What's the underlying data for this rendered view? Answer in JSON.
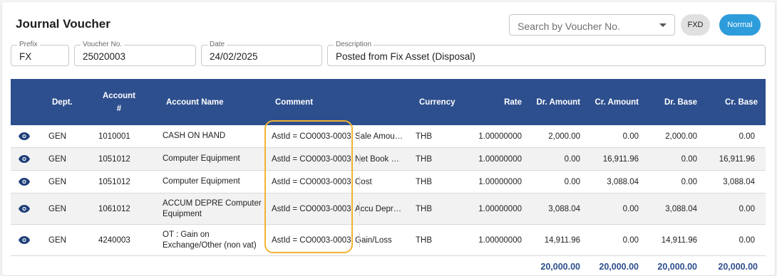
{
  "header": {
    "title": "Journal Voucher",
    "search_placeholder": "Search by Voucher No.",
    "pill_fxd": "FXD",
    "pill_normal": "Normal"
  },
  "form": {
    "prefix": {
      "label": "Prefix",
      "value": "FX"
    },
    "voucher_no": {
      "label": "Voucher No.",
      "value": "25020003"
    },
    "date": {
      "label": "Date",
      "value": "24/02/2025"
    },
    "description": {
      "label": "Description",
      "value": "Posted from Fix Asset (Disposal)"
    }
  },
  "table": {
    "columns": {
      "dept": "Dept.",
      "account_no_1": "Account",
      "account_no_2": "#",
      "account_name": "Account Name",
      "comment": "Comment",
      "currency": "Currency",
      "rate": "Rate",
      "dr_amount": "Dr. Amount",
      "cr_amount": "Cr. Amount",
      "dr_base": "Dr. Base",
      "cr_base": "Cr. Base"
    },
    "rows": [
      {
        "dept": "GEN",
        "account": "1010001",
        "account_name": "CASH ON HAND",
        "comment_key": "AstId = CO0003-0003",
        "comment_desc": "Sale Amou…",
        "currency": "THB",
        "rate": "1.00000000",
        "dr_amount": "2,000.00",
        "cr_amount": "0.00",
        "dr_base": "2,000.00",
        "cr_base": "0.00"
      },
      {
        "dept": "GEN",
        "account": "1051012",
        "account_name": "Computer Equipment",
        "comment_key": "AstId = CO0003-0003",
        "comment_desc": "Net Book …",
        "currency": "THB",
        "rate": "1.00000000",
        "dr_amount": "0.00",
        "cr_amount": "16,911.96",
        "dr_base": "0.00",
        "cr_base": "16,911.96"
      },
      {
        "dept": "GEN",
        "account": "1051012",
        "account_name": "Computer Equipment",
        "comment_key": "AstId = CO0003-0003",
        "comment_desc": "Cost",
        "currency": "THB",
        "rate": "1.00000000",
        "dr_amount": "0.00",
        "cr_amount": "3,088.04",
        "dr_base": "0.00",
        "cr_base": "3,088.04"
      },
      {
        "dept": "GEN",
        "account": "1061012",
        "account_name": "ACCUM DEPRE Computer Equipment",
        "comment_key": "AstId = CO0003-0003",
        "comment_desc": "Accu Depr…",
        "currency": "THB",
        "rate": "1.00000000",
        "dr_amount": "3,088.04",
        "cr_amount": "0.00",
        "dr_base": "3,088.04",
        "cr_base": "0.00"
      },
      {
        "dept": "GEN",
        "account": "4240003",
        "account_name": "OT : Gain on Exchange/Other (non vat)",
        "comment_key": "AstId = CO0003-0003",
        "comment_desc": "Gain/Loss",
        "currency": "THB",
        "rate": "1.00000000",
        "dr_amount": "14,911.96",
        "cr_amount": "0.00",
        "dr_base": "14,911.96",
        "cr_base": "0.00"
      }
    ],
    "totals": {
      "dr_amount": "20,000.00",
      "cr_amount": "20,000.00",
      "dr_base": "20,000.00",
      "cr_base": "20,000.00"
    }
  },
  "icons": {
    "row_view": "eye-icon",
    "dropdown": "chevron-down-icon"
  },
  "colors": {
    "header_bg": "#2d4f8e",
    "accent": "#2d9cdb",
    "highlight": "#f2b233",
    "totals_text": "#2d4f8e"
  }
}
